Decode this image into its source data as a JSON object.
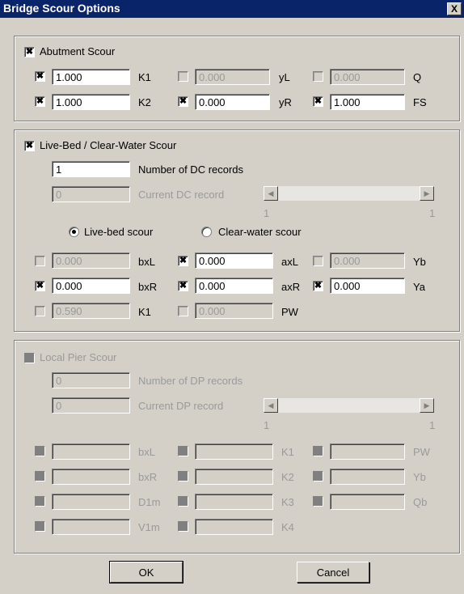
{
  "window": {
    "title": "Bridge Scour Options",
    "close_label": "X"
  },
  "abutment": {
    "label": "Abutment Scour",
    "k1": {
      "value": "1.000",
      "label": "K1"
    },
    "k2": {
      "value": "1.000",
      "label": "K2"
    },
    "yl": {
      "value": "0.000",
      "label": "yL"
    },
    "yr": {
      "value": "0.000",
      "label": "yR"
    },
    "q": {
      "value": "0.000",
      "label": "Q"
    },
    "fs": {
      "value": "1.000",
      "label": "FS"
    }
  },
  "livebed": {
    "label": "Live-Bed / Clear-Water Scour",
    "num_dc": {
      "value": "1",
      "label": "Number of DC records"
    },
    "cur_dc": {
      "value": "0",
      "label": "Current DC record"
    },
    "scroll_min": "1",
    "scroll_max": "1",
    "radio_live": "Live-bed scour",
    "radio_clear": "Clear-water scour",
    "bxl": {
      "value": "0.000",
      "label": "bxL"
    },
    "bxr": {
      "value": "0.000",
      "label": "bxR"
    },
    "k1": {
      "value": "0.590",
      "label": "K1"
    },
    "axl": {
      "value": "0.000",
      "label": "axL"
    },
    "axr": {
      "value": "0.000",
      "label": "axR"
    },
    "pw": {
      "value": "0.000",
      "label": "PW"
    },
    "yb": {
      "value": "0.000",
      "label": "Yb"
    },
    "ya": {
      "value": "0.000",
      "label": "Ya"
    }
  },
  "pier": {
    "label": "Local Pier Scour",
    "num_dp": {
      "value": "0",
      "label": "Number of DP records"
    },
    "cur_dp": {
      "value": "0",
      "label": "Current DP record"
    },
    "scroll_min": "1",
    "scroll_max": "1",
    "col1": [
      "bxL",
      "bxR",
      "D1m",
      "V1m"
    ],
    "col2": [
      "K1",
      "K2",
      "K3",
      "K4"
    ],
    "col3": [
      "PW",
      "Yb",
      "Qb"
    ]
  },
  "buttons": {
    "ok": "OK",
    "cancel": "Cancel"
  },
  "icons": {
    "check": "✖",
    "left_arrow": "◀",
    "right_arrow": "▶"
  }
}
